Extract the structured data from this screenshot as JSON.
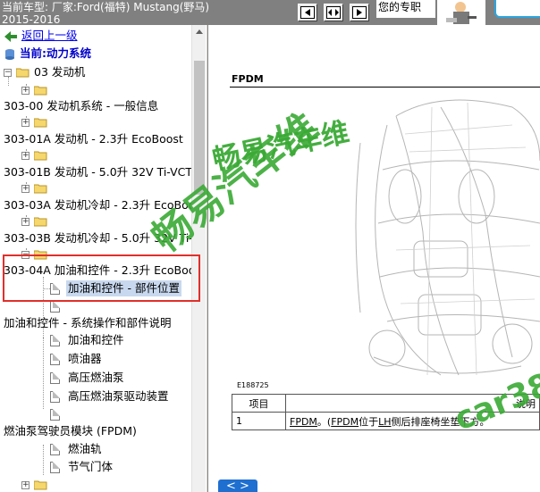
{
  "topbar": {
    "vehicle_line1": "当前车型:  厂家:Ford(福特) Mustang(野马)",
    "vehicle_line2": "2015-2016",
    "welcome_text": "您的专职",
    "nav_buttons": [
      "prev-page",
      "expand",
      "next-page"
    ]
  },
  "tree": {
    "back_link": "返回上一级",
    "current_label": "当前:动力系统",
    "root_folder": "03 发动机",
    "sections": [
      "303-00 发动机系统 - 一般信息",
      "303-01A 发动机 - 2.3升 EcoBoost",
      "303-01B 发动机 - 5.0升 32V Ti-VCT",
      "303-03A 发动机冷却 - 2.3升 EcoBoost",
      "303-03B 发动机冷却 - 5.0升 32V Ti-VCT",
      "303-04A 加油和控件 - 2.3升 EcoBoost"
    ],
    "selected_doc": "加油和控件 - 部件位置",
    "subsection_1": "加油和控件 - 系统操作和部件说明",
    "sub_docs_1": [
      "加油和控件",
      "喷油器",
      "高压燃油泵",
      "高压燃油泵驱动装置"
    ],
    "subsection_2": "燃油泵驾驶员模块 (FPDM)",
    "sub_docs_2": [
      "燃油轨",
      "节气门体"
    ]
  },
  "document": {
    "title": "FPDM",
    "image_code": "E188725",
    "table": {
      "headers": [
        "项目",
        "说明"
      ],
      "row_num": "1",
      "row_link1": "FPDM",
      "row_mid": "。(",
      "row_link2": "FPDM",
      "row_mid2": "位于",
      "row_link3": "LH",
      "row_tail": "侧后排座椅坐垫下方。"
    },
    "watermark_1": "畅易汽车维",
    "watermark_2": "畅易汽车维",
    "watermark_3": "car38",
    "prev_button": "< >"
  },
  "colors": {
    "highlight": "#e0302b",
    "watermark": "#3aaa35",
    "topbar": "#808080",
    "link": "#0000ee"
  }
}
